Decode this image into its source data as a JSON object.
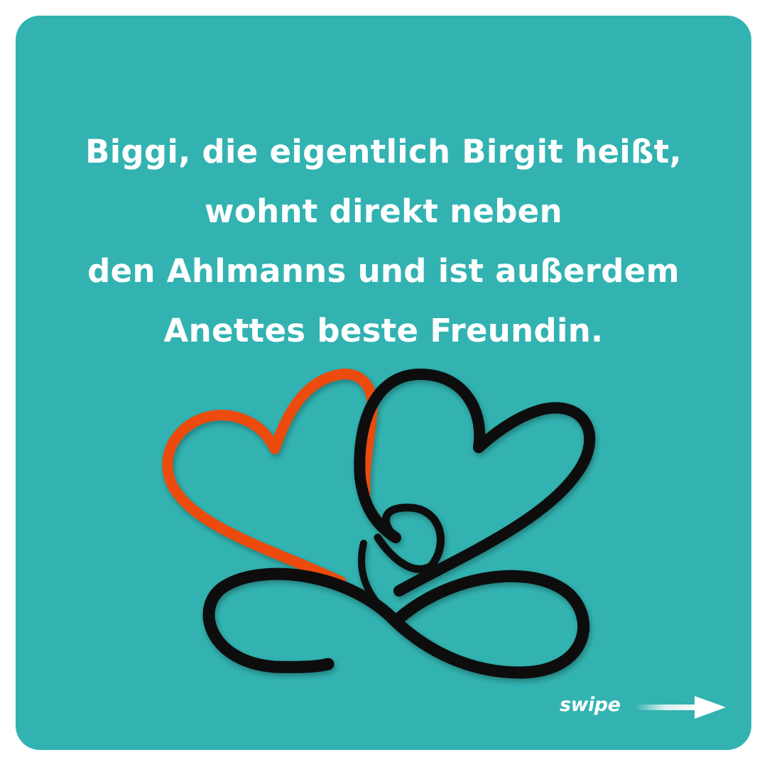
{
  "colors": {
    "background": "#ffffff",
    "card": "#32b3b1",
    "text": "#ffffff",
    "heart_orange": "#ec4c10",
    "heart_black": "#0c0c0c"
  },
  "headline": {
    "lines": [
      "Biggi, die eigentlich Birgit heißt,",
      "wohnt direkt neben",
      "den Ahlmanns und ist außerdem",
      "Anettes beste Freundin."
    ]
  },
  "logo": {
    "icon": "two-hearts-infinity-logo"
  },
  "swipe": {
    "label": "swipe",
    "icon": "arrow-right-icon"
  }
}
